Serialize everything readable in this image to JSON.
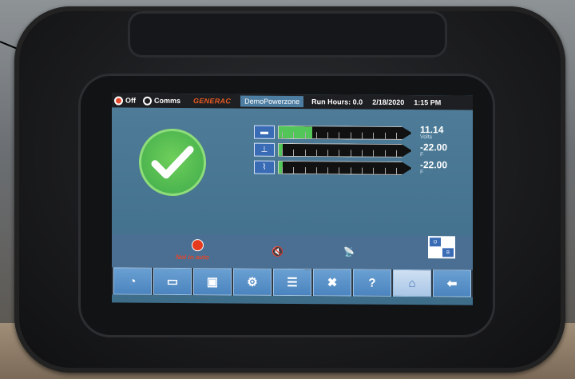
{
  "status_bar": {
    "off_label": "Off",
    "comms_label": "Comms",
    "brand": "GENERAC",
    "site_name": "DemoPowerzone",
    "run_hours": "Run Hours: 0.0",
    "date": "2/18/2020",
    "time": "1:15 PM"
  },
  "status_check": "ok",
  "gauges": [
    {
      "icon": "battery-icon",
      "value": "11.14",
      "unit": "Volts",
      "level": 0.25
    },
    {
      "icon": "coolant-temp-icon",
      "value": "-22.00",
      "unit": "F",
      "level": 0.03
    },
    {
      "icon": "oil-icon",
      "value": "-22.00",
      "unit": "F",
      "level": 0.03
    }
  ],
  "lower_bar": {
    "not_in_auto_label": "Not in auto",
    "ob_labels": [
      "O",
      "B"
    ]
  },
  "nav": [
    {
      "name": "nav-dashboard-button",
      "icon": "gauge-icon",
      "glyph": "◔"
    },
    {
      "name": "nav-engine-button",
      "icon": "engine-icon",
      "glyph": "▭"
    },
    {
      "name": "nav-generator-button",
      "icon": "generator-icon",
      "glyph": "▣"
    },
    {
      "name": "nav-settings-button",
      "icon": "gears-icon",
      "glyph": "⚙"
    },
    {
      "name": "nav-adjust-button",
      "icon": "sliders-icon",
      "glyph": "☰"
    },
    {
      "name": "nav-tools-button",
      "icon": "tools-icon",
      "glyph": "✖"
    },
    {
      "name": "nav-help-button",
      "icon": "question-icon",
      "glyph": "?"
    },
    {
      "name": "nav-home-button",
      "icon": "home-icon",
      "glyph": "⌂",
      "active": true
    },
    {
      "name": "nav-back-button",
      "icon": "back-arrow-icon",
      "glyph": "⬅"
    }
  ],
  "colors": {
    "accent": "#3a6bb5",
    "ok": "#53c65a",
    "alert": "#e64a2e",
    "brand": "#e85a22"
  }
}
